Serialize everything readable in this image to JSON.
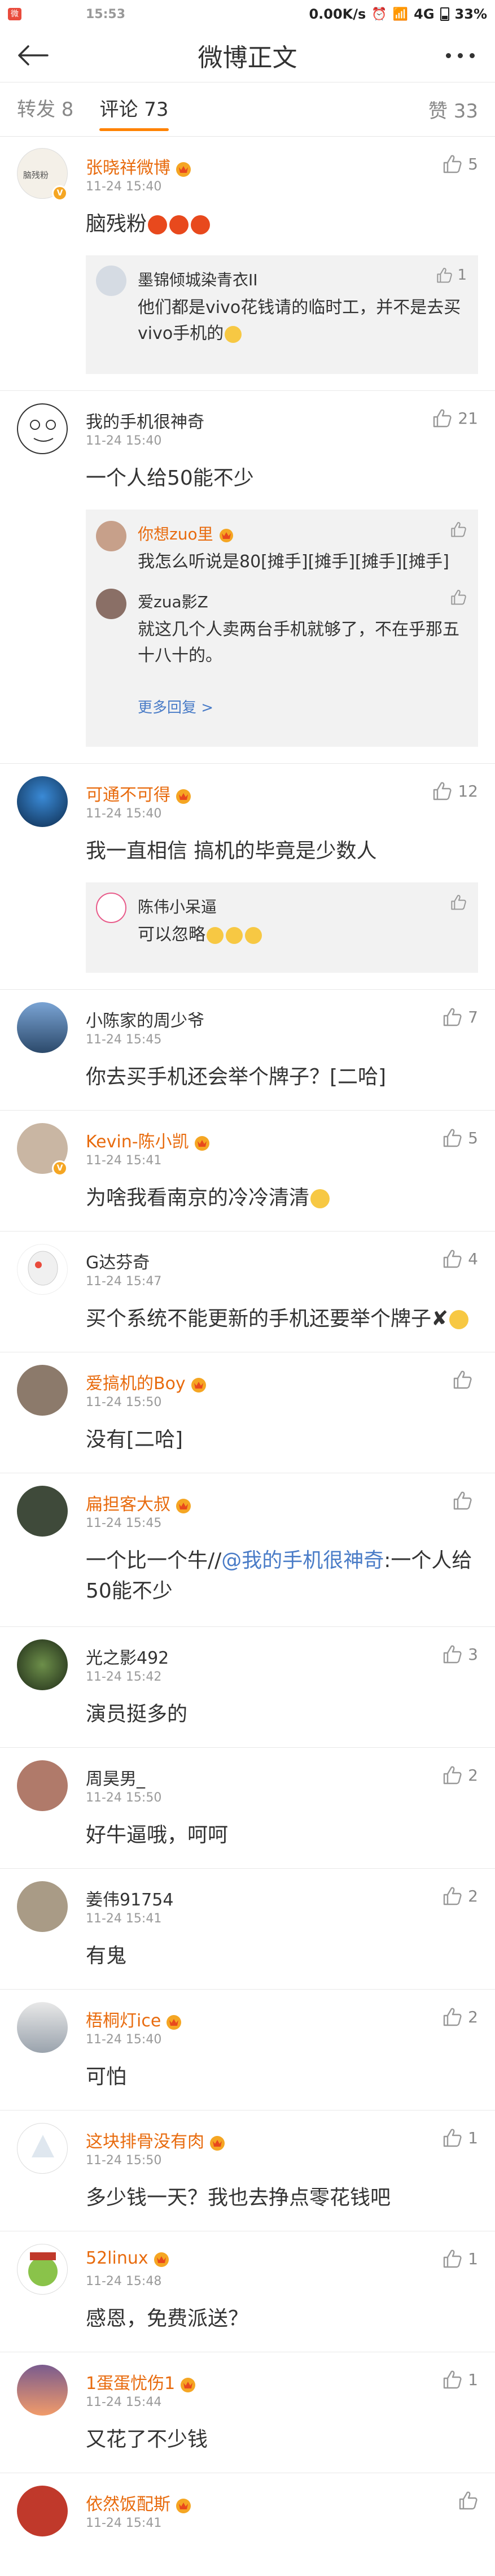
{
  "status": {
    "time": "15:53",
    "notif": "微",
    "speed": "0.00K/s",
    "network": "4G",
    "battery": "33%"
  },
  "nav": {
    "title": "微博正文"
  },
  "tabs": {
    "repost": "转发 8",
    "comments": "评论 73",
    "likes": "赞 33"
  },
  "comments": [
    {
      "name": "张晓祥微博",
      "time": "11-24 15:40",
      "text": "脑残粉",
      "likes": "5",
      "reply": {
        "name": "墨锦倾城染青衣II",
        "text": "他们都是vivo花钱请的临时工，并不是去买vivo手机的",
        "likes": "1"
      }
    },
    {
      "name": "我的手机很神奇",
      "time": "11-24 15:40",
      "text": "一个人给50能不少",
      "likes": "21",
      "replies": [
        {
          "name": "你想zuo里",
          "text": "我怎么听说是80[摊手][摊手][摊手][摊手]"
        },
        {
          "name": "爱zua影Z",
          "text": "就这几个人卖两台手机就够了，不在乎那五十八十的。"
        }
      ],
      "more": "更多回复 >"
    },
    {
      "name": "可通不可得",
      "time": "11-24 15:40",
      "text": "我一直相信 搞机的毕竟是少数人",
      "likes": "12",
      "reply": {
        "name": "陈伟小呆逼",
        "text": "可以忽略"
      }
    },
    {
      "name": "小陈家的周少爷",
      "time": "11-24 15:45",
      "text": "你去买手机还会举个牌子？[二哈]",
      "likes": "7"
    },
    {
      "name": "Kevin-陈小凯",
      "time": "11-24 15:41",
      "text": "为啥我看南京的冷冷清清",
      "likes": "5"
    },
    {
      "name": "G达芬奇",
      "time": "11-24 15:47",
      "text": "买个系统不能更新的手机还要举个牌子",
      "likes": "4"
    },
    {
      "name": "爱搞机的Boy",
      "time": "11-24 15:50",
      "text": "没有[二哈]",
      "likes": ""
    },
    {
      "name": "扁担客大叔",
      "time": "11-24 15:45",
      "text_a": "一个比一个牛//",
      "text_link": "@我的手机很神奇",
      "text_b": ":一个人给50能不少",
      "likes": ""
    },
    {
      "name": "光之影492",
      "time": "11-24 15:42",
      "text": "演员挺多的",
      "likes": "3"
    },
    {
      "name": "周昊男_",
      "time": "11-24 15:50",
      "text": "好牛逼哦，呵呵",
      "likes": "2"
    },
    {
      "name": "姜伟91754",
      "time": "11-24 15:41",
      "text": "有鬼",
      "likes": "2"
    },
    {
      "name": "梧桐灯ice",
      "time": "11-24 15:40",
      "text": "可怕",
      "likes": "2"
    },
    {
      "name": "这块排骨没有肉",
      "time": "11-24 15:50",
      "text": "多少钱一天？我也去挣点零花钱吧",
      "likes": "1"
    },
    {
      "name": "52linux",
      "time": "11-24 15:48",
      "text": "感恩，免费派送？",
      "likes": "1"
    },
    {
      "name": "1蛋蛋忧伤1",
      "time": "11-24 15:44",
      "text": "又花了不少钱",
      "likes": "1"
    },
    {
      "name": "依然饭配斯",
      "time": "11-24 15:41",
      "text": "",
      "likes": ""
    }
  ],
  "colors": {
    "accent": "#ff8200",
    "vip_name": "#e86b0e",
    "link": "#4a7cc7"
  }
}
